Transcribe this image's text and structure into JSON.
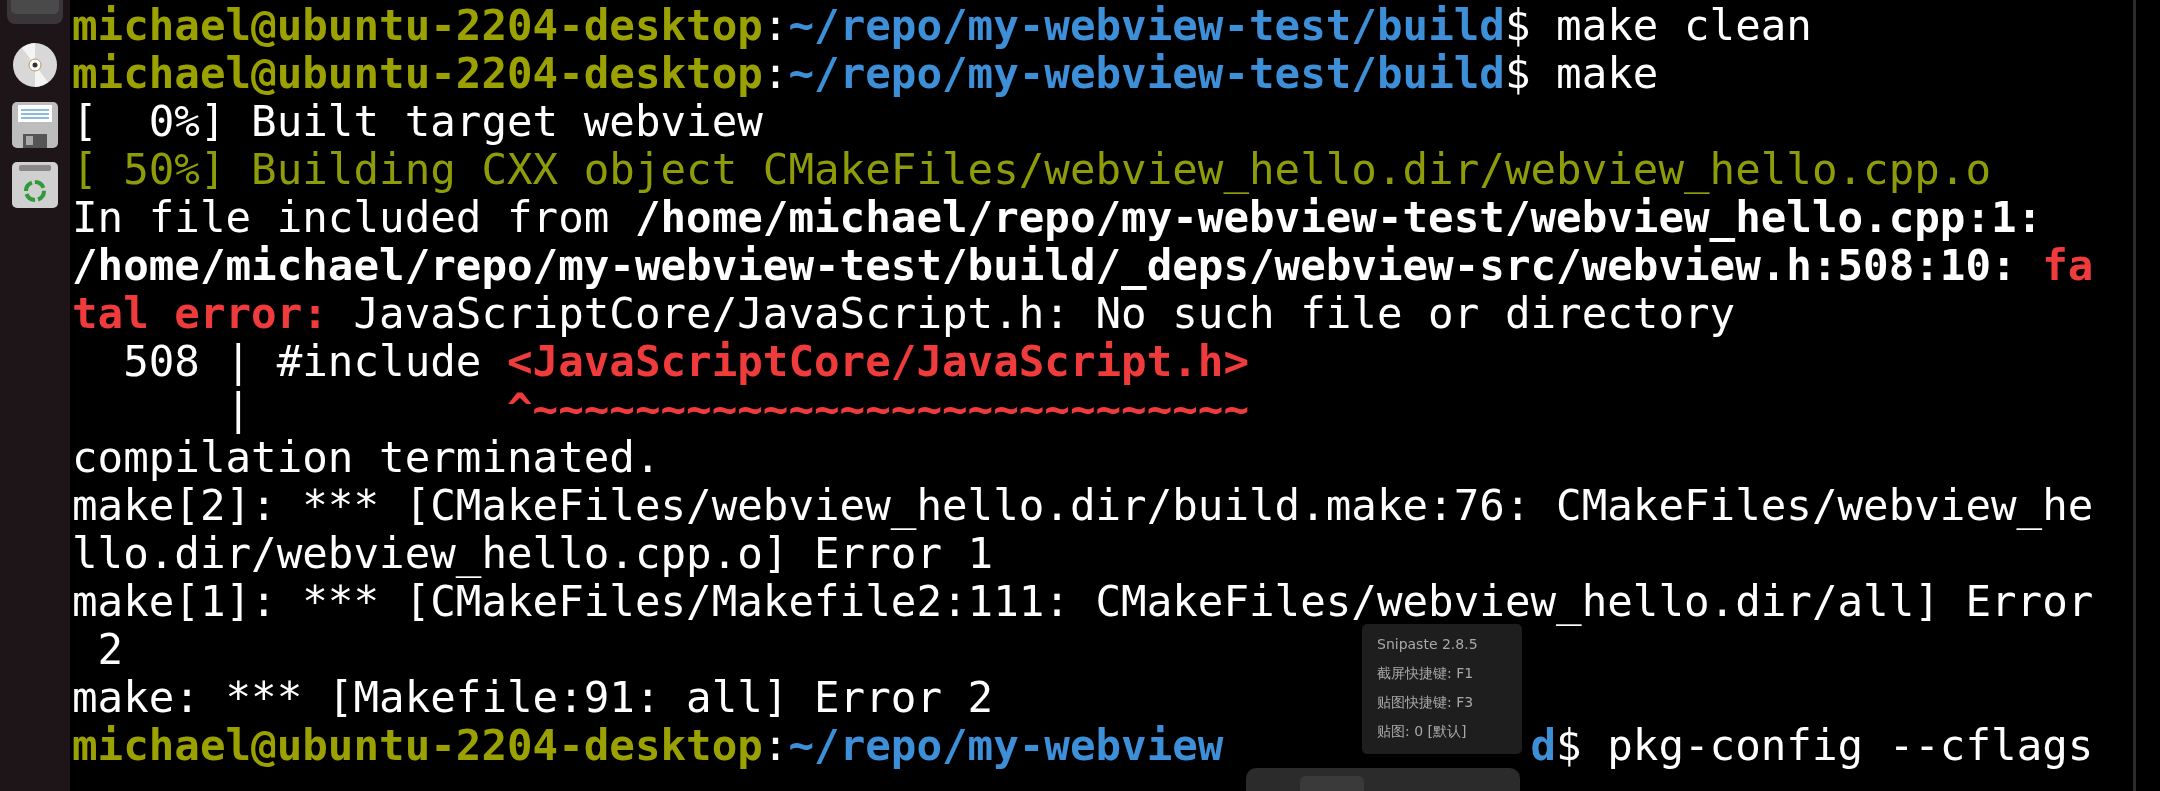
{
  "dock": {
    "items": [
      {
        "kind": "app"
      },
      {
        "kind": "disc"
      },
      {
        "kind": "floppy"
      },
      {
        "kind": "trash"
      }
    ]
  },
  "terminal": {
    "lines": [
      {
        "segments": [
          {
            "text": "michael@ubuntu-2204-desktop",
            "kind": "user"
          },
          {
            "text": ":",
            "kind": "plain"
          },
          {
            "text": "~/repo/my-webview-test/build",
            "kind": "path"
          },
          {
            "text": "$ make clean",
            "kind": "plain"
          }
        ]
      },
      {
        "segments": [
          {
            "text": "michael@ubuntu-2204-desktop",
            "kind": "user"
          },
          {
            "text": ":",
            "kind": "plain"
          },
          {
            "text": "~/repo/my-webview-test/build",
            "kind": "path"
          },
          {
            "text": "$ make",
            "kind": "plain"
          }
        ]
      },
      {
        "segments": [
          {
            "text": "[  0%] Built target webview",
            "kind": "plain"
          }
        ]
      },
      {
        "segments": [
          {
            "text": "[ 50%] Building CXX object CMakeFiles/webview_hello.dir/webview_hello.cpp.o",
            "kind": "progress"
          }
        ]
      },
      {
        "segments": [
          {
            "text": "In file included from ",
            "kind": "plain"
          },
          {
            "text": "/home/michael/repo/my-webview-test/webview_hello.cpp:1:",
            "kind": "bold"
          }
        ]
      },
      {
        "segments": [
          {
            "text": "/home/michael/repo/my-webview-test/build/_deps/webview-src/webview.h:508:10: ",
            "kind": "bold"
          },
          {
            "text": "fa",
            "kind": "error"
          }
        ]
      },
      {
        "segments": [
          {
            "text": "tal error:",
            "kind": "error"
          },
          {
            "text": " JavaScriptCore/JavaScript.h: No such file or directory",
            "kind": "plain"
          }
        ]
      },
      {
        "segments": [
          {
            "text": "  508 | #include ",
            "kind": "plain"
          },
          {
            "text": "<JavaScriptCore/JavaScript.h>",
            "kind": "error"
          }
        ]
      },
      {
        "segments": [
          {
            "text": "      |          ",
            "kind": "plain"
          },
          {
            "text": "^~~~~~~~~~~~~~~~~~~~~~~~~~~~~",
            "kind": "error"
          }
        ]
      },
      {
        "segments": [
          {
            "text": "compilation terminated.",
            "kind": "plain"
          }
        ]
      },
      {
        "segments": [
          {
            "text": "make[2]: *** [CMakeFiles/webview_hello.dir/build.make:76: CMakeFiles/webview_he",
            "kind": "plain"
          }
        ]
      },
      {
        "segments": [
          {
            "text": "llo.dir/webview_hello.cpp.o] Error 1",
            "kind": "plain"
          }
        ]
      },
      {
        "segments": [
          {
            "text": "make[1]: *** [CMakeFiles/Makefile2:111: CMakeFiles/webview_hello.dir/all] Error",
            "kind": "plain"
          }
        ]
      },
      {
        "segments": [
          {
            "text": " 2",
            "kind": "plain"
          }
        ]
      },
      {
        "segments": [
          {
            "text": "make: *** [Makefile:91: all] Error 2",
            "kind": "plain"
          }
        ]
      },
      {
        "segments": [
          {
            "text": "michael@ubuntu-2204-desktop",
            "kind": "user"
          },
          {
            "text": ":",
            "kind": "plain"
          },
          {
            "text": "~/repo/my-webview",
            "kind": "path"
          },
          {
            "text": "d",
            "kind": "covered-path"
          },
          {
            "text": "$ pkg-config --cflags",
            "kind": "plain"
          }
        ]
      }
    ]
  },
  "tooltip": {
    "lines": [
      "Snipaste 2.8.5",
      "截屏快捷键: F1",
      "贴图快捷键: F3",
      "贴图: 0 [默认]"
    ]
  },
  "popup": {
    "kind": "panel"
  }
}
